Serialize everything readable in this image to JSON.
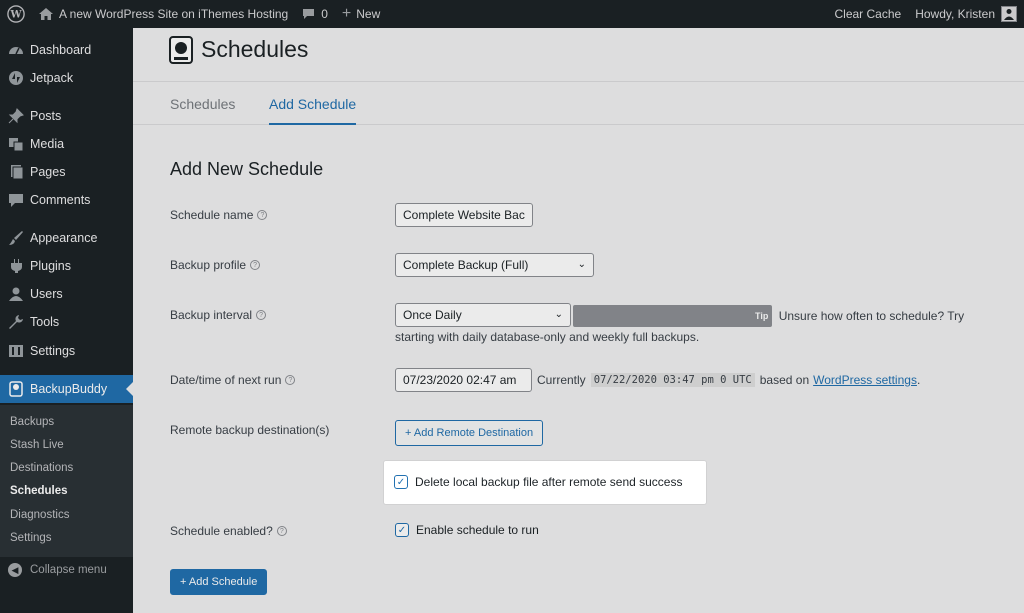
{
  "admin_bar": {
    "site_name": "A new WordPress Site on iThemes Hosting",
    "comments_count": "0",
    "new_label": "New",
    "clear_cache": "Clear Cache",
    "howdy": "Howdy, Kristen"
  },
  "sidebar": {
    "items": [
      {
        "label": "Dashboard",
        "icon": "dashboard-icon"
      },
      {
        "label": "Jetpack",
        "icon": "jetpack-icon"
      },
      {
        "label": "Posts",
        "icon": "pin-icon"
      },
      {
        "label": "Media",
        "icon": "media-icon"
      },
      {
        "label": "Pages",
        "icon": "pages-icon"
      },
      {
        "label": "Comments",
        "icon": "comment-icon"
      },
      {
        "label": "Appearance",
        "icon": "brush-icon"
      },
      {
        "label": "Plugins",
        "icon": "plugin-icon"
      },
      {
        "label": "Users",
        "icon": "user-icon"
      },
      {
        "label": "Tools",
        "icon": "wrench-icon"
      },
      {
        "label": "Settings",
        "icon": "settings-icon"
      },
      {
        "label": "BackupBuddy",
        "icon": "backupbuddy-icon"
      }
    ],
    "submenu": [
      "Backups",
      "Stash Live",
      "Destinations",
      "Schedules",
      "Diagnostics",
      "Settings"
    ],
    "collapse_label": "Collapse menu"
  },
  "page": {
    "title": "Schedules",
    "tabs": [
      "Schedules",
      "Add Schedule"
    ],
    "form_title": "Add New Schedule"
  },
  "form": {
    "schedule_name_label": "Schedule name",
    "schedule_name_value": "Complete Website Bac",
    "backup_profile_label": "Backup profile",
    "backup_profile_value": "Complete Backup (Full)",
    "backup_interval_label": "Backup interval",
    "backup_interval_value": "Once Daily",
    "tip_badge": "Tip",
    "tip_text": "Unsure how often to schedule? Try starting with daily database-only and weekly full backups.",
    "next_run_label": "Date/time of next run",
    "next_run_value": "07/23/2020 02:47 am",
    "currently_text": "Currently",
    "current_time": "07/22/2020 03:47 pm 0 UTC",
    "based_on_text": "based on",
    "wp_settings_link": "WordPress settings",
    "period": ".",
    "remote_label": "Remote backup destination(s)",
    "add_remote_button": "+ Add Remote Destination",
    "delete_local_label": "Delete local backup file after remote send success",
    "schedule_enabled_label": "Schedule enabled?",
    "enable_run_label": "Enable schedule to run",
    "add_schedule_button": "+ Add Schedule"
  }
}
